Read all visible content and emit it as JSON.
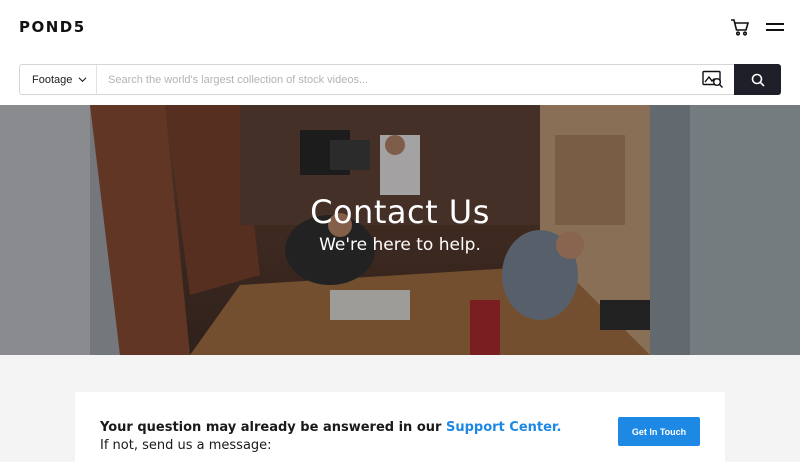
{
  "header": {
    "logo": "POND5",
    "cart_icon": "cart-icon",
    "menu_icon": "hamburger-menu-icon"
  },
  "search": {
    "media_type": "Footage",
    "placeholder": "Search the world's largest collection of stock videos...",
    "value": "",
    "visual_search_icon": "image-search-icon",
    "submit_icon": "magnifier-icon"
  },
  "hero": {
    "title": "Contact Us",
    "subtitle": "We're here to help."
  },
  "contact": {
    "line1_prefix": "Your question may already be answered in our ",
    "support_link": "Support Center.",
    "line2": "If not, send us a message:",
    "cta_label": "Get In Touch"
  },
  "colors": {
    "accent": "#1e88e5",
    "search_button": "#1f1f29"
  }
}
